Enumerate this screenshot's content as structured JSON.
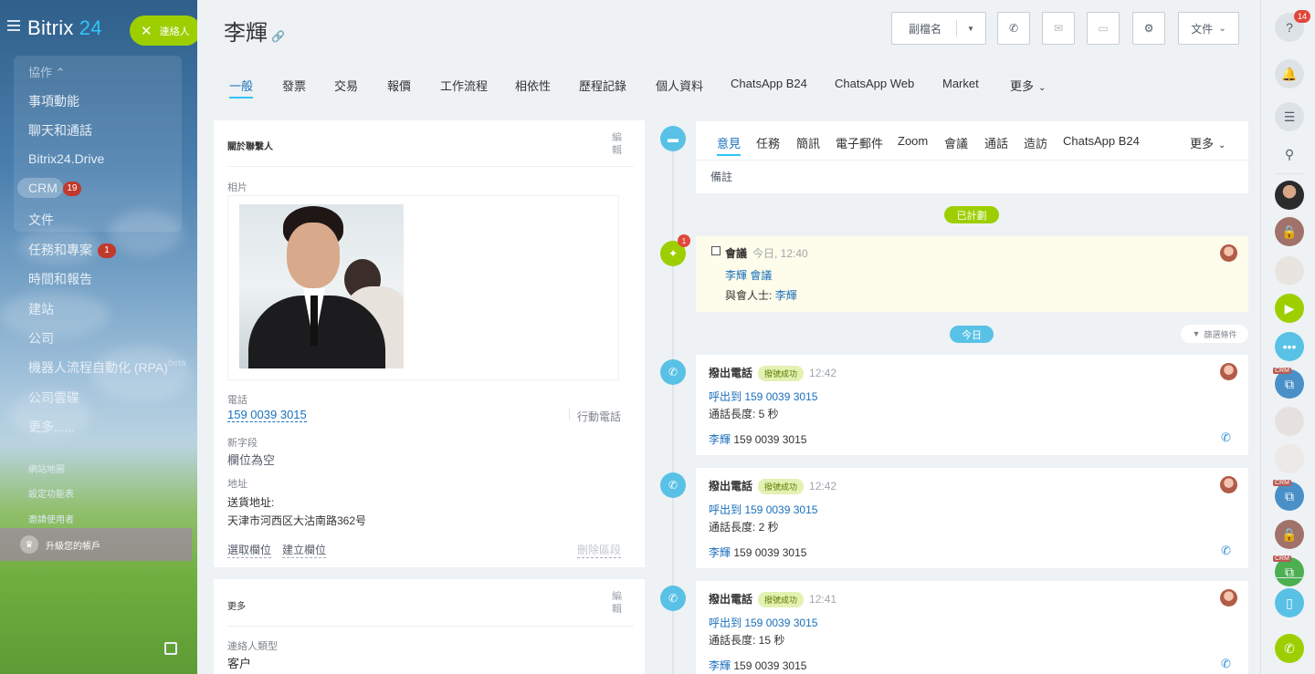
{
  "sidebar": {
    "logo_text": "Bitrix",
    "logo_num": "24",
    "contact_pill": "連絡人",
    "group_head": "協作 ⌃",
    "items": [
      {
        "label": "事項動能"
      },
      {
        "label": "聊天和通話"
      },
      {
        "label": "Bitrix24.Drive"
      },
      {
        "label": "CRM",
        "badge": "19"
      },
      {
        "label": "文件"
      },
      {
        "label": "任務和專案",
        "badge": "1"
      },
      {
        "label": "時間和報告"
      },
      {
        "label": "建站"
      },
      {
        "label": "公司"
      },
      {
        "label": "機器人流程自動化 (RPA)",
        "sup": "beta"
      },
      {
        "label": "公司雲碟"
      },
      {
        "label": "更多......"
      }
    ],
    "small_items": [
      "網站地圖",
      "設定功能表",
      "邀請使用者"
    ],
    "upgrade": "升級您的帳戶"
  },
  "header": {
    "title": "李輝",
    "buttons": {
      "sub_name": "副檔名",
      "document": "文件"
    }
  },
  "tabs": [
    "一般",
    "發票",
    "交易",
    "報價",
    "工作流程",
    "相依性",
    "歷程記錄",
    "個人資料",
    "ChatsApp B24",
    "ChatsApp Web",
    "Market",
    "更多"
  ],
  "about": {
    "heading": "關於聯繫人",
    "edit": "編輯",
    "photo_label": "相片",
    "phone_label": "電話",
    "phone_value": "159 0039 3015",
    "phone_type": "行動電話",
    "new_field_label": "新字段",
    "new_field_value": "欄位為空",
    "address_label": "地址",
    "address_type": "送貨地址:",
    "address_value": "天津市河西区大沽南路362号",
    "select_field": "選取欄位",
    "create_field": "建立欄位",
    "delete_section": "刪除區段"
  },
  "more": {
    "heading": "更多",
    "edit": "編輯",
    "type_label": "連絡人類型",
    "type_value": "客户"
  },
  "timeline": {
    "tabs": [
      "意見",
      "任務",
      "簡訊",
      "電子郵件",
      "Zoom",
      "會議",
      "通話",
      "造訪",
      "ChatsApp B24",
      "更多"
    ],
    "note": "備註",
    "planned_label": "已計劃",
    "today_label": "今日",
    "filter_label": "篩選條件",
    "meeting": {
      "badge": "1",
      "title": "會議",
      "time": "今日, 12:40",
      "subject": "李輝 會議",
      "participants_label": "與會人士:",
      "participant": "李輝"
    },
    "calls": [
      {
        "title": "撥出電話",
        "status": "撥號成功",
        "time": "12:42",
        "to": "呼出到 159 0039 3015",
        "duration": "通話長度: 5 秒",
        "contact": "李輝",
        "number": "159 0039 3015"
      },
      {
        "title": "撥出電話",
        "status": "撥號成功",
        "time": "12:42",
        "to": "呼出到 159 0039 3015",
        "duration": "通話長度: 2 秒",
        "contact": "李輝",
        "number": "159 0039 3015"
      },
      {
        "title": "撥出電話",
        "status": "撥號成功",
        "time": "12:41",
        "to": "呼出到 159 0039 3015",
        "duration": "通話長度: 15 秒",
        "contact": "李輝",
        "number": "159 0039 3015"
      }
    ]
  },
  "rightbar": {
    "help_badge": "14",
    "crm_label": "CRM"
  }
}
